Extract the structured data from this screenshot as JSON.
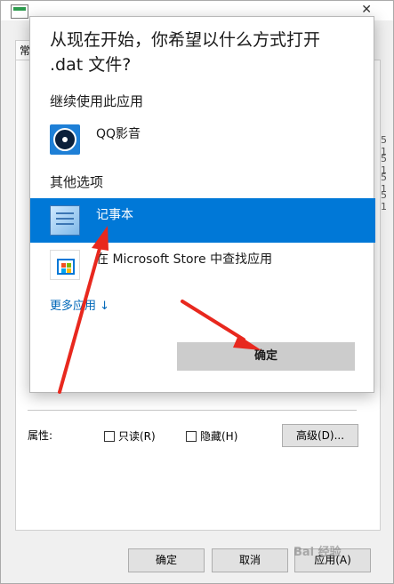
{
  "props_dialog": {
    "tab_label": "常",
    "attributes_label": "属性:",
    "readonly_label": "只读(R)",
    "hidden_label": "隐藏(H)",
    "advanced_button": "高级(D)...",
    "ok_button": "确定",
    "cancel_button": "取消",
    "apply_button": "应用(A)",
    "edge_values": [
      "5 1",
      "5 1",
      "5 1",
      "5 1"
    ]
  },
  "open_with": {
    "question": "从现在开始，你希望以什么方式打开 .dat 文件?",
    "continue_section": "继续使用此应用",
    "other_section": "其他选项",
    "apps": [
      {
        "name": "QQ影音",
        "icon": "qq-player-icon"
      },
      {
        "name": "记事本",
        "icon": "notepad-icon",
        "selected": true
      },
      {
        "name": "在 Microsoft Store 中查找应用",
        "icon": "microsoft-store-icon"
      }
    ],
    "more_apps_link": "更多应用 ↓",
    "confirm_button": "确定"
  },
  "colors": {
    "selection": "#0078d7",
    "link": "#0067b8",
    "arrow": "#e8281e"
  },
  "watermark": "Bai 经验"
}
